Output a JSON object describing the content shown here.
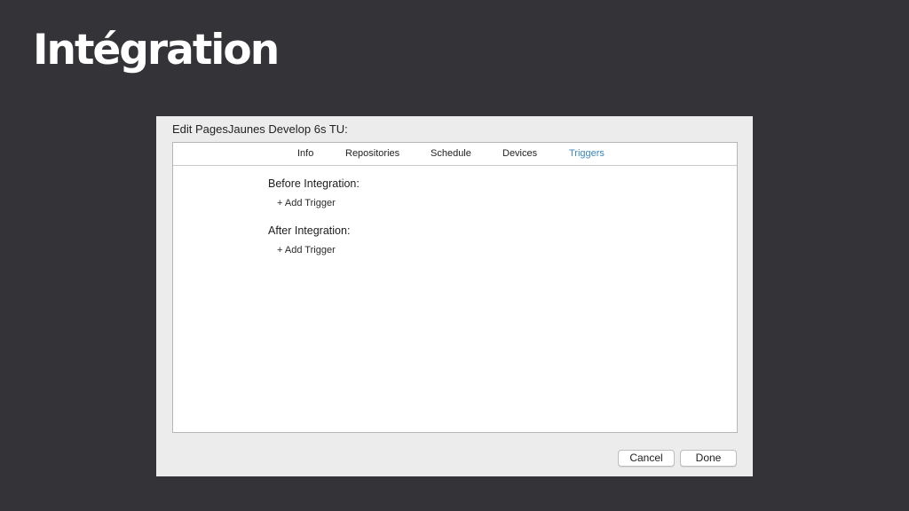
{
  "slide": {
    "title": "Intégration"
  },
  "sheet": {
    "title": "Edit PagesJaunes Develop 6s TU:",
    "tabs": [
      {
        "label": "Info",
        "active": false
      },
      {
        "label": "Repositories",
        "active": false
      },
      {
        "label": "Schedule",
        "active": false
      },
      {
        "label": "Devices",
        "active": false
      },
      {
        "label": "Triggers",
        "active": true
      }
    ],
    "before": {
      "heading": "Before Integration:",
      "add_label": "+ Add Trigger"
    },
    "after": {
      "heading": "After Integration:",
      "add_label": "+ Add Trigger"
    },
    "buttons": {
      "cancel": "Cancel",
      "done": "Done"
    }
  },
  "colors": {
    "background": "#333338",
    "active_tab": "#3a86c4",
    "sheet": "#ececec"
  }
}
